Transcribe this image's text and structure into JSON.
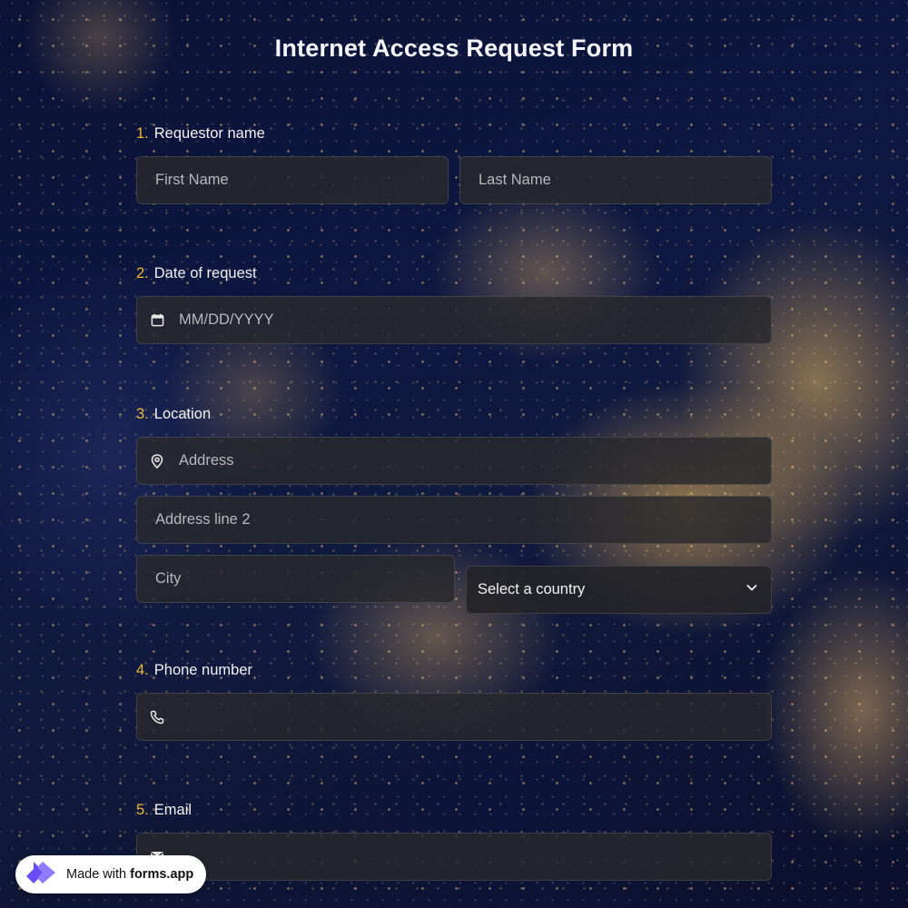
{
  "form": {
    "title": "Internet Access Request Form"
  },
  "questions": {
    "q1": {
      "number": "1.",
      "label": "Requestor name",
      "first_name_placeholder": "First Name",
      "last_name_placeholder": "Last Name"
    },
    "q2": {
      "number": "2.",
      "label": "Date of request",
      "date_placeholder": "MM/DD/YYYY"
    },
    "q3": {
      "number": "3.",
      "label": "Location",
      "address_placeholder": "Address",
      "address2_placeholder": "Address line 2",
      "city_placeholder": "City",
      "country_selected": "Select a country"
    },
    "q4": {
      "number": "4.",
      "label": "Phone number",
      "phone_placeholder": ""
    },
    "q5": {
      "number": "5.",
      "label": "Email",
      "email_placeholder": ""
    }
  },
  "badge": {
    "prefix": "Made with",
    "brand": "forms.app"
  },
  "colors": {
    "accent_number": "#e9b93a",
    "field_bg": "#28282c",
    "logo_purple": "#6a4cf5"
  },
  "icons": {
    "date": "calendar-icon",
    "address": "map-pin-icon",
    "country": "chevron-down-icon",
    "phone": "phone-icon",
    "email": "mail-icon",
    "badge": "forms-app-logo-icon"
  }
}
